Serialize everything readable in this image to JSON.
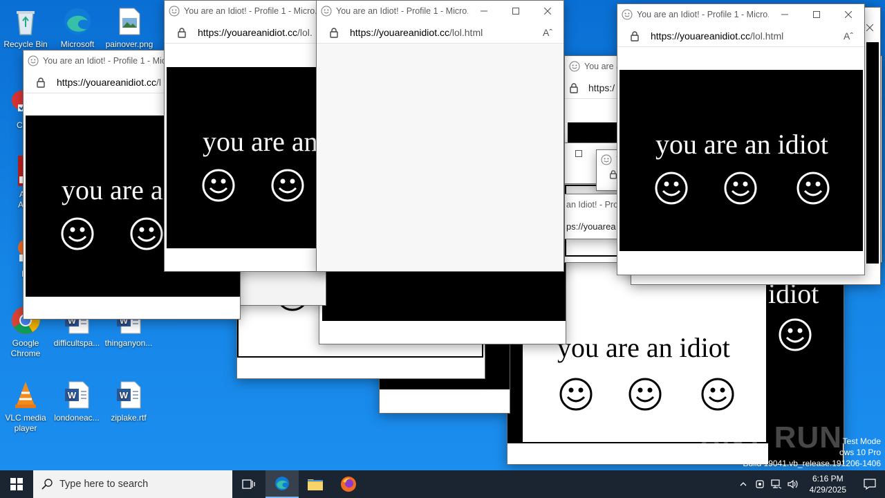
{
  "desktop": {
    "icons": [
      {
        "label": "Recycle Bin",
        "icon": "recycle-bin-icon"
      },
      {
        "label": "Microsoft",
        "icon": "edge-icon"
      },
      {
        "label": "painover.png",
        "icon": "image-file-icon"
      },
      {
        "label": "CCl",
        "icon": "ccleaner-icon"
      },
      {
        "label": "Ac Acr",
        "icon": "acrobat-icon"
      },
      {
        "label": "Fir",
        "icon": "firefox-icon"
      },
      {
        "label": "Google Chrome",
        "icon": "chrome-icon"
      },
      {
        "label": "difficultspa...",
        "icon": "word-document-icon"
      },
      {
        "label": "thinganyon...",
        "icon": "word-document-icon"
      },
      {
        "label": "VLC media player",
        "icon": "vlc-icon"
      },
      {
        "label": "londoneac...",
        "icon": "word-document-icon"
      },
      {
        "label": "ziplake.rtf",
        "icon": "word-document-icon"
      }
    ]
  },
  "popup": {
    "title_full": "You are an Idiot! - Profile 1 - Micro...",
    "title_cut": "You are an Idiot! - Profile 1 - Micro",
    "title_short": "You are an Idi",
    "title_frag": "an Idiot! - Pro",
    "title_letter": "Y",
    "url_host": "https://youareanidiot.cc",
    "url_path": "/lol.html",
    "url_path_cut": "/lol.",
    "url_path_cut2": "/l",
    "url_frag": "https:/",
    "url_frag2": "ps://youarea",
    "message": "you are an idiot",
    "message_cut1": "you are a",
    "message_cut2": "you are an",
    "message_cut3": "idiot",
    "reader_mode": "Aˆ"
  },
  "taskbar": {
    "search_placeholder": "Type here to search",
    "time": "6:16 PM",
    "date": "4/29/2025"
  },
  "overlay": {
    "watermark": "ANY RUN",
    "test_mode_line1": "Test Mode",
    "test_mode_line2": "ows 10 Pro",
    "test_mode_line3": "Build 19041.vb_release.191206-1406"
  }
}
